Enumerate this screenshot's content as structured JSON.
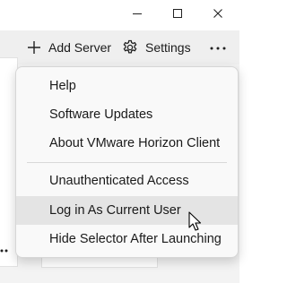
{
  "toolbar": {
    "add_server_label": "Add Server",
    "settings_label": "Settings"
  },
  "menu": {
    "items": [
      {
        "label": "Help"
      },
      {
        "label": "Software Updates"
      },
      {
        "label": "About VMware Horizon Client"
      },
      {
        "label": "Unauthenticated Access"
      },
      {
        "label": "Log in As Current User",
        "hovered": true
      },
      {
        "label": "Hide Selector After Launching"
      }
    ]
  },
  "icons": {
    "minimize": "minimize-icon",
    "maximize": "maximize-icon",
    "close": "close-icon",
    "add": "plus-icon",
    "settings": "gear-icon",
    "more": "more-icon",
    "cursor": "mouse-pointer-icon"
  },
  "colors": {
    "toolbar_bg": "#efefef",
    "menu_bg": "#f9f9f9",
    "hover_bg": "#e4e4e4"
  }
}
